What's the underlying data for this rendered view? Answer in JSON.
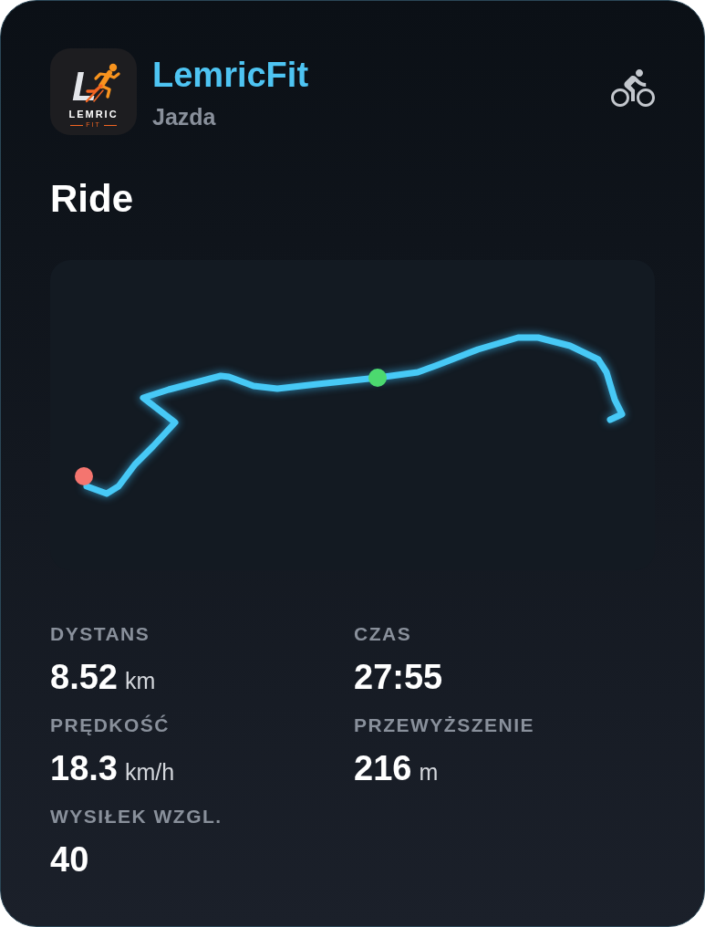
{
  "app": {
    "logo": {
      "monogram": "L",
      "wordmark": "LEMRIC",
      "tagline": "FIT"
    },
    "name": "LemricFit",
    "subtitle": "Jazda"
  },
  "activity": {
    "title": "Ride"
  },
  "stats": [
    {
      "label": "DYSTANS",
      "value": "8.52",
      "unit": "km"
    },
    {
      "label": "CZAS",
      "value": "27:55"
    },
    {
      "label": "PRĘDKOŚĆ",
      "value": "18.3",
      "unit": "km/h"
    },
    {
      "label": "PRZEWYŻSZENIE",
      "value": "216",
      "unit": "m"
    },
    {
      "label": "WYSIŁEK WZGL.",
      "value": "40"
    }
  ]
}
